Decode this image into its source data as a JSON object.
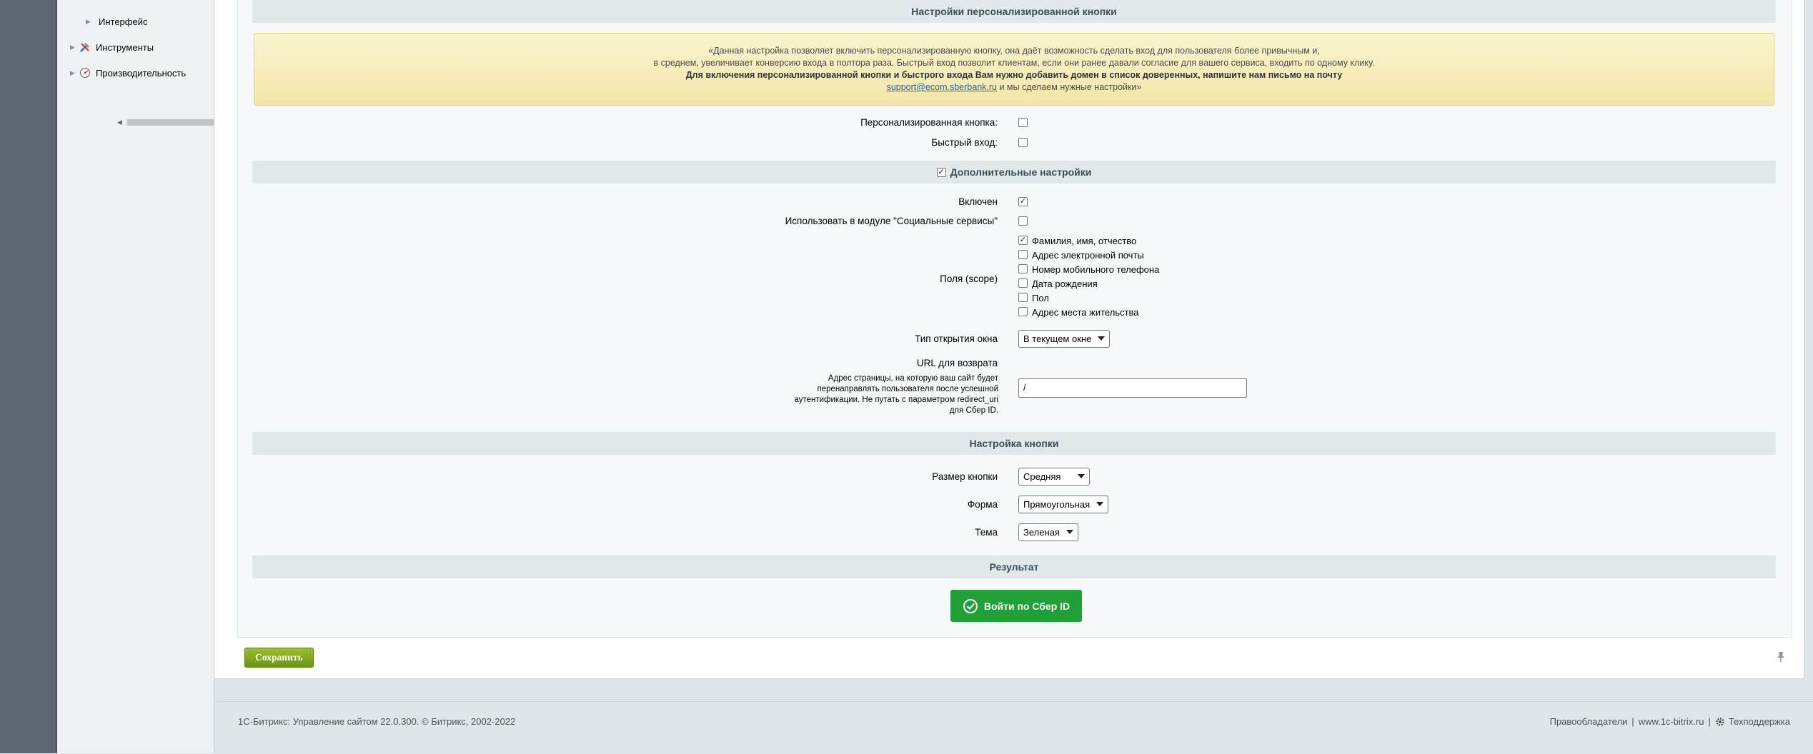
{
  "sidebar": {
    "items": [
      {
        "label": "Интерфейс",
        "icon": "none"
      },
      {
        "label": "Инструменты",
        "icon": "tools-icon"
      },
      {
        "label": "Производительность",
        "icon": "gauge-icon"
      }
    ]
  },
  "sections": {
    "personal_button_title": "Настройки персонализированной кнопки",
    "additional_title": "Дополнительные настройки",
    "button_settings_title": "Настройка кнопки",
    "result_title": "Результат"
  },
  "notice": {
    "line1": "«Данная настройка позволяет включить персонализированную кнопку, она даёт возможность сделать вход для пользователя более привычным и,",
    "line2": "в среднем, увеличивает конверсию входа в полтора раза. Быстрый вход позволит клиентам, если они ранее давали согласие для вашего сервиса, входить по одному клику.",
    "line3": "Для включения персонализированной кнопки и быстрого входа Вам нужно добавить домен в список доверенных, напишите нам письмо на почту",
    "email": "support@ecom.sberbank.ru",
    "line4_suffix": " и мы сделаем нужные настройки»"
  },
  "fields": {
    "personal_button_label": "Персонализированная кнопка:",
    "personal_button_checked": false,
    "fast_login_label": "Быстрый вход:",
    "fast_login_checked": false,
    "additional_checked": true,
    "enabled_label": "Включен",
    "enabled_checked": true,
    "social_label": "Использовать в модуле \"Социальные сервисы\"",
    "social_checked": false,
    "scope_label": "Поля (scope)",
    "scope_options": [
      {
        "label": "Фамилия, имя, отчество",
        "checked": true
      },
      {
        "label": "Адрес электронной почты",
        "checked": false
      },
      {
        "label": "Номер мобильного телефона",
        "checked": false
      },
      {
        "label": "Дата рождения",
        "checked": false
      },
      {
        "label": "Пол",
        "checked": false
      },
      {
        "label": "Адрес места жительства",
        "checked": false
      }
    ],
    "window_type_label": "Тип открытия окна",
    "window_type_value": "В текущем окне",
    "return_url_label": "URL для возврата",
    "return_url_hint": "Адрес страницы, на которую ваш сайт будет перенаправлять пользователя после успешной аутентификации. Не путать с параметром redirect_uri для Сбер ID.",
    "return_url_value": "/",
    "button_size_label": "Размер кнопки",
    "button_size_value": "Средняя",
    "shape_label": "Форма",
    "shape_value": "Прямоугольная",
    "theme_label": "Тема",
    "theme_value": "Зеленая"
  },
  "result": {
    "sber_button_label": "Войти по Сбер ID",
    "sber_color": "#21a038"
  },
  "actions": {
    "save_label": "Сохранить"
  },
  "footer": {
    "copyright": "1С-Битрикс: Управление сайтом 22.0.300. © Битрикс, 2002-2022",
    "rights_link": "Правообладатели",
    "site_link": "www.1c-bitrix.ru",
    "support_link": "Техподдержка",
    "separator": "|"
  }
}
